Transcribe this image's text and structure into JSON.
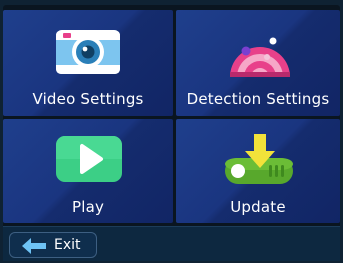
{
  "menu": {
    "tiles": [
      {
        "label": "Video Settings",
        "icon": "camera-icon"
      },
      {
        "label": "Detection Settings",
        "icon": "radar-icon"
      },
      {
        "label": "Play",
        "icon": "play-icon"
      },
      {
        "label": "Update",
        "icon": "download-icon"
      }
    ]
  },
  "footer": {
    "exit_label": "Exit",
    "exit_icon": "arrow-left-icon"
  },
  "colors": {
    "tile_background": "#1a3580",
    "screen_background": "#0a1520",
    "play_green": "#3ccf86",
    "update_green": "#58a82c",
    "update_arrow": "#f2e23a",
    "camera_blue": "#7dc5ef",
    "radar_pink": "#e8408a",
    "exit_arrow": "#6ec3f5"
  }
}
